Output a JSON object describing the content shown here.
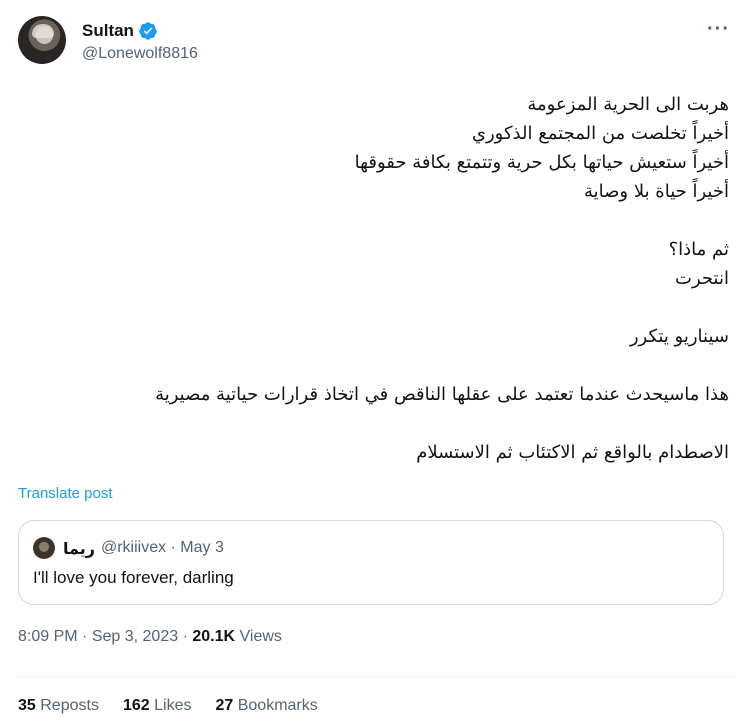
{
  "author": {
    "display_name": "Sultan",
    "handle": "@Lonewolf8816",
    "verified_color": "#1d9bf0"
  },
  "post": {
    "lines": [
      "هربت الى الحرية المزعومة",
      "أخيراً تخلصت من المجتمع الذكوري",
      "أخيراً ستعيش حياتها بكل حرية وتتمتع بكافة حقوقها",
      "أخيراً حياة بلا وصاية",
      "",
      "ثم ماذا؟",
      "انتحرت",
      "",
      "سيناريو يتكرر",
      "",
      "هذا ماسيحدث عندما تعتمد على عقلها الناقص في اتخاذ قرارات حياتية مصيرية",
      "",
      "الاصطدام بالواقع ثم الاكتئاب ثم الاستسلام"
    ],
    "translate_label": "Translate post"
  },
  "quoted": {
    "name": "ريما",
    "meta": "@rkiiivex · May 3",
    "text": "I'll love you forever, darling"
  },
  "meta": {
    "time": "8:09 PM",
    "date": "Sep 3, 2023",
    "views_count": "20.1K",
    "views_label": "Views"
  },
  "stats": {
    "reposts_count": "35",
    "reposts_label": "Reposts",
    "likes_count": "162",
    "likes_label": "Likes",
    "bookmarks_count": "27",
    "bookmarks_label": "Bookmarks"
  },
  "icons": {
    "more": "more-icon",
    "verified": "verified-badge-icon"
  }
}
